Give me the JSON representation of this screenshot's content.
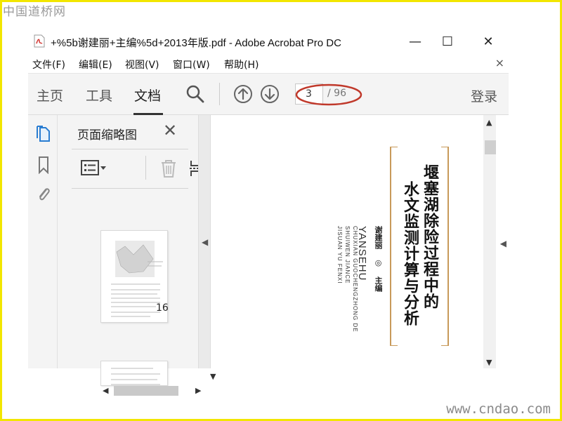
{
  "watermark": {
    "top_left": "中国道桥网",
    "bottom_right": "www.cndao.com"
  },
  "window": {
    "title": "+%5b谢建丽+主编%5d+2013年版.pdf - Adobe Acrobat Pro DC",
    "controls": {
      "minimize": "—",
      "maximize": "☐",
      "close": "✕"
    }
  },
  "menu": {
    "items": [
      {
        "label": "文件(F)"
      },
      {
        "label": "编辑(E)"
      },
      {
        "label": "视图(V)"
      },
      {
        "label": "窗口(W)"
      },
      {
        "label": "帮助(H)"
      }
    ],
    "close": "×"
  },
  "toolbar": {
    "tabs": [
      {
        "label": "主页",
        "active": false
      },
      {
        "label": "工具",
        "active": false
      },
      {
        "label": "文档",
        "active": true
      }
    ],
    "page_current": "3",
    "page_total": "/ 96",
    "login": "登录",
    "annotation_color": "#c0392b"
  },
  "thumbnail_panel": {
    "title": "页面缩略图",
    "close": "✕",
    "thumb_page_label": "16"
  },
  "document": {
    "title_line1": "堰塞湖除险过程中的",
    "title_line2": "水文监测计算与分析",
    "editor": "谢建丽 ◎ 主编",
    "pinyin_title": "YANSEHU",
    "pinyin_line2": "CHUXIAN GUOCHENGZHONG DE",
    "pinyin_line3": "SHUIWEN JIANCE",
    "pinyin_line4": "JISUAN YU FENXI",
    "accent_color": "#c89a5a"
  }
}
